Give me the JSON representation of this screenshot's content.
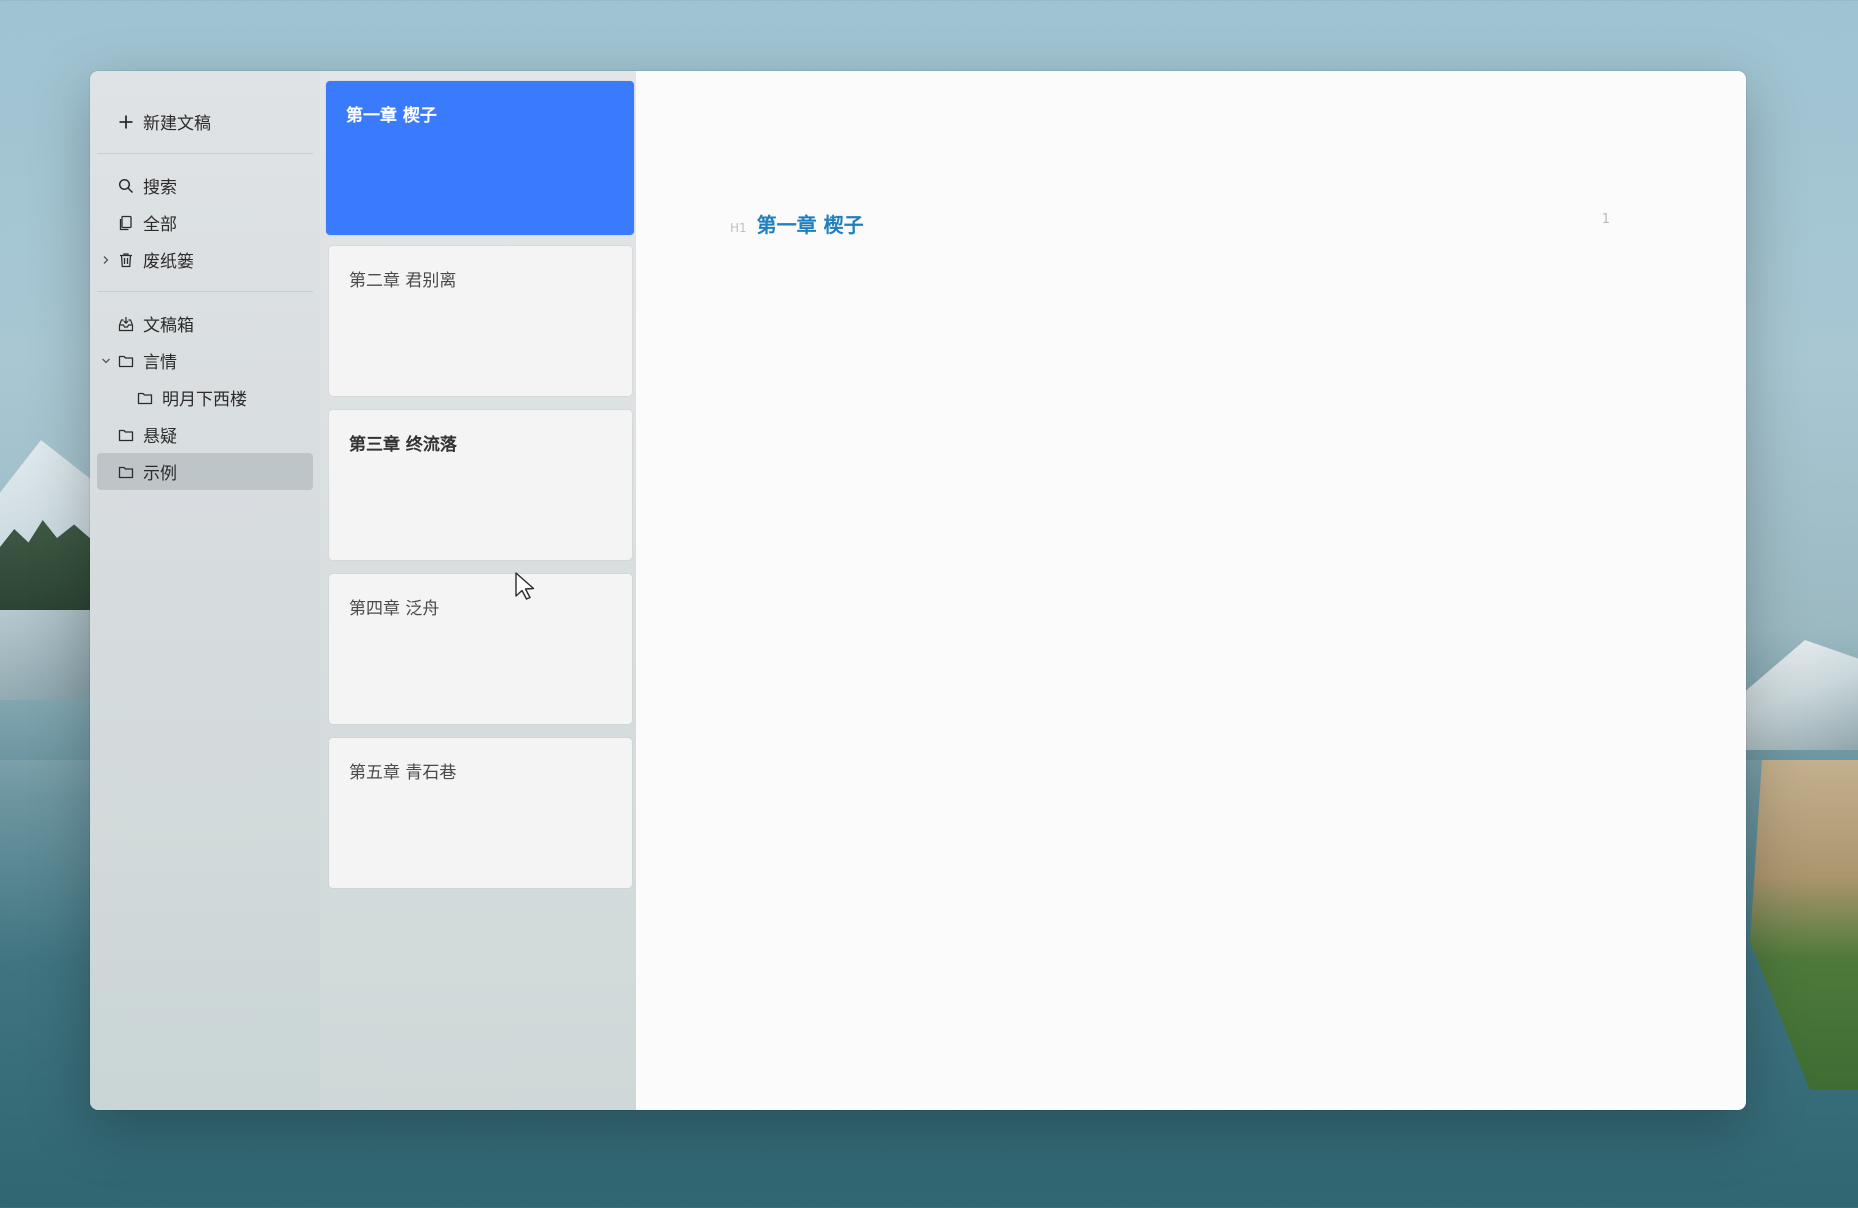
{
  "sidebar": {
    "new_label": "新建文稿",
    "search_label": "搜索",
    "all_label": "全部",
    "trash_label": "废纸篓",
    "inbox_label": "文稿箱",
    "folders": [
      {
        "label": "言情",
        "expanded": true,
        "children": [
          {
            "label": "明月下西楼"
          }
        ]
      },
      {
        "label": "悬疑"
      },
      {
        "label": "示例",
        "selected": true
      }
    ]
  },
  "notes": [
    {
      "title": "第一章 楔子",
      "active": true
    },
    {
      "title": "第二章 君别离"
    },
    {
      "title": "第三章 终流落",
      "bold": true
    },
    {
      "title": "第四章 泛舟"
    },
    {
      "title": "第五章 青石巷"
    }
  ],
  "editor": {
    "heading_tag": "H1",
    "heading_text": "第一章 楔子",
    "line_number": "1",
    "heading_color": "#1f7fbf"
  },
  "colors": {
    "accent": "#3a7bfd"
  },
  "icons": {
    "new": "plus-icon",
    "search": "search-icon",
    "all": "documents-icon",
    "trash": "trash-icon",
    "inbox": "inbox-icon",
    "folder": "folder-icon"
  }
}
